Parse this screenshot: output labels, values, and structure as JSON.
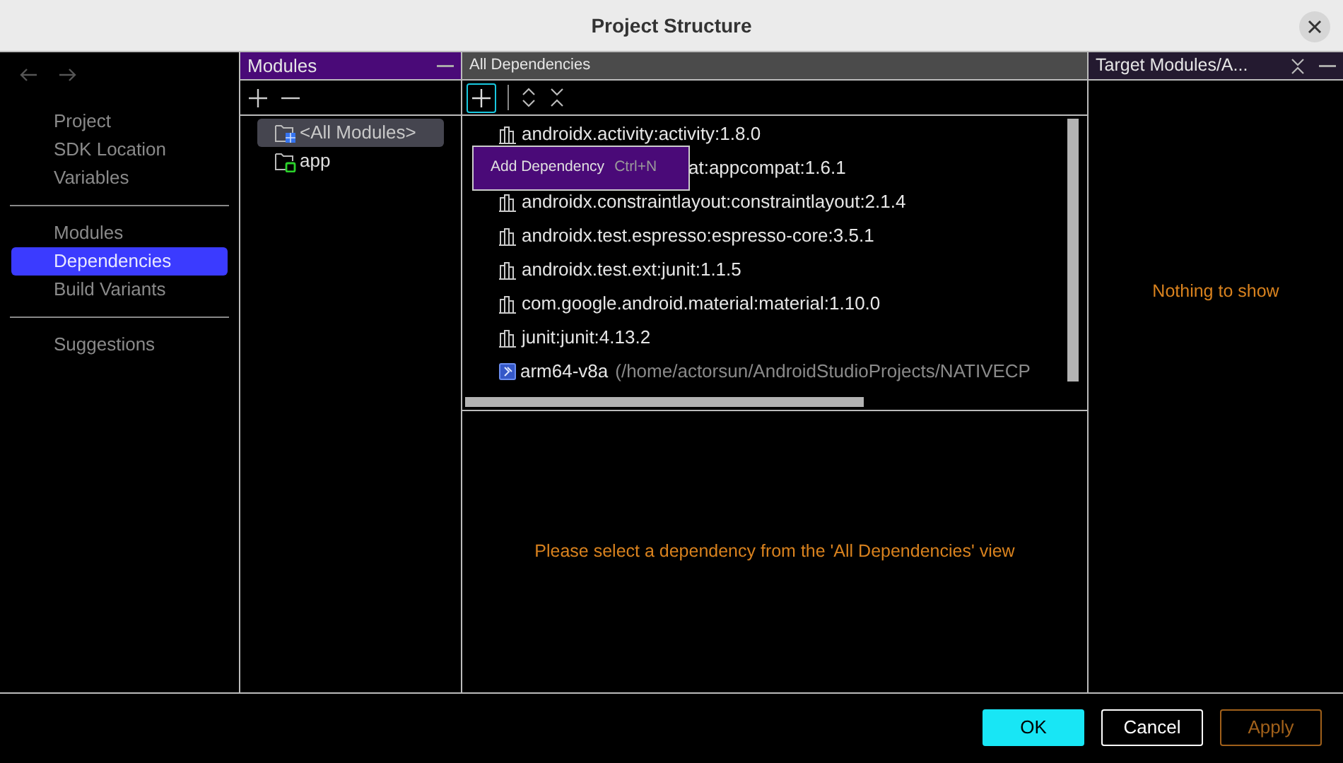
{
  "window": {
    "title": "Project Structure"
  },
  "nav": {
    "groups": [
      [
        {
          "label": "Project",
          "selected": false
        },
        {
          "label": "SDK Location",
          "selected": false
        },
        {
          "label": "Variables",
          "selected": false
        }
      ],
      [
        {
          "label": "Modules",
          "selected": false
        },
        {
          "label": "Dependencies",
          "selected": true
        },
        {
          "label": "Build Variants",
          "selected": false
        }
      ],
      [
        {
          "label": "Suggestions",
          "selected": false
        }
      ]
    ]
  },
  "modules_panel": {
    "title": "Modules",
    "items": [
      {
        "label": "<All Modules>",
        "kind": "all",
        "selected": true
      },
      {
        "label": "app",
        "kind": "module",
        "selected": false
      }
    ]
  },
  "dependencies_panel": {
    "title": "All Dependencies",
    "tooltip": {
      "label": "Add Dependency",
      "shortcut": "Ctrl+N"
    },
    "items": [
      {
        "name": "androidx.activity:activity:1.8.0",
        "kind": "library"
      },
      {
        "name": "at:appcompat:1.6.1",
        "kind": "covered"
      },
      {
        "name": "androidx.constraintlayout:constraintlayout:2.1.4",
        "kind": "library"
      },
      {
        "name": "androidx.test.espresso:espresso-core:3.5.1",
        "kind": "library"
      },
      {
        "name": "androidx.test.ext:junit:1.1.5",
        "kind": "library"
      },
      {
        "name": "com.google.android.material:material:1.10.0",
        "kind": "library"
      },
      {
        "name": "junit:junit:4.13.2",
        "kind": "library"
      },
      {
        "name": "arm64-v8a",
        "path": "(/home/actorsun/AndroidStudioProjects/NATIVECP",
        "kind": "native"
      }
    ],
    "empty_message": "Please select a dependency from the 'All Dependencies' view"
  },
  "target_panel": {
    "title": "Target Modules/A...",
    "empty_message": "Nothing to show"
  },
  "buttons": [
    {
      "label": "OK",
      "kind": "primary"
    },
    {
      "label": "Cancel",
      "kind": "secondary"
    },
    {
      "label": "Apply",
      "kind": "apply"
    }
  ]
}
